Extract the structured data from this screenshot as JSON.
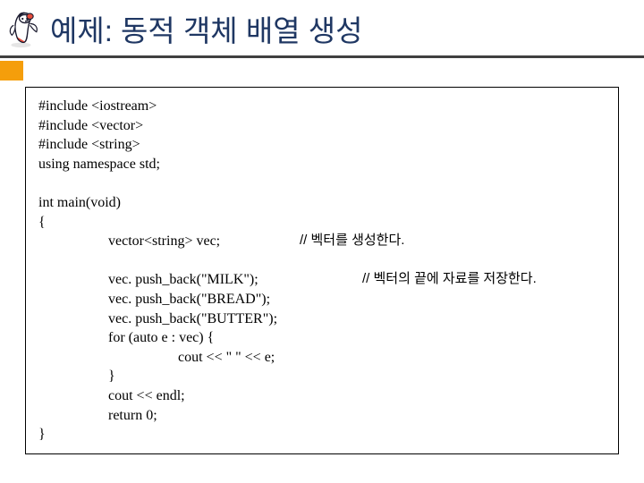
{
  "header": {
    "title": "예제: 동적 객체 배열 생성"
  },
  "code": {
    "l1": "#include <iostream>",
    "l2": "#include <vector>",
    "l3": "#include <string>",
    "l4": "using namespace std;",
    "blank1": " ",
    "l5": "int main(void)",
    "l6": "{",
    "l7a": "vector<string> vec;",
    "l7b": "// 벡터를 생성한다.",
    "blank2": " ",
    "l8a": "vec. push_back(\"MILK\");",
    "l8b": "// 벡터의 끝에 자료를 저장한다.",
    "l9": "vec. push_back(\"BREAD\");",
    "l10": "vec. push_back(\"BUTTER\");",
    "l11": "for (auto e : vec) {",
    "l12": "cout << \" \" << e;",
    "l13": "}",
    "l14": "cout << endl;",
    "l15": "return 0;",
    "l16": "}"
  }
}
